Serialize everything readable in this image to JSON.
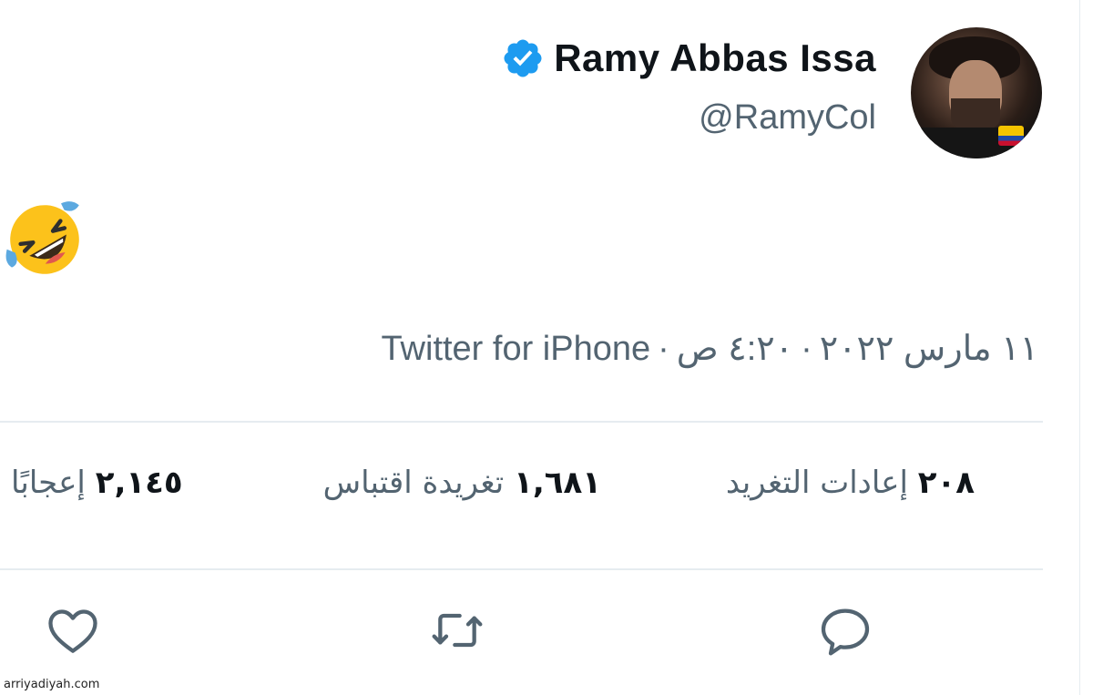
{
  "user": {
    "display_name": "Ramy Abbas Issa",
    "handle": "@RamyCol",
    "verified": true,
    "verified_color": "#1d9bf0"
  },
  "tweet": {
    "emoji": "rolling-on-the-floor-laughing",
    "time": "٤:٢٠ ص",
    "date": "١١ مارس ٢٠٢٢",
    "source": "Twitter for iPhone",
    "separator": "·"
  },
  "stats": {
    "retweets_count": "٢٠٨",
    "retweets_label": "إعادات التغريد",
    "quotes_count": "١,٦٨١",
    "quotes_label": "تغريدة اقتباس",
    "likes_count": "٢,١٤٥",
    "likes_label": "إعجابًا"
  },
  "actions": {
    "icons": [
      "reply-icon",
      "retweet-icon",
      "like-icon"
    ]
  },
  "watermark": "arriyadiyah.com",
  "colors": {
    "text_primary": "#0f1419",
    "text_secondary": "#536471",
    "divider": "#e6ecf0"
  }
}
